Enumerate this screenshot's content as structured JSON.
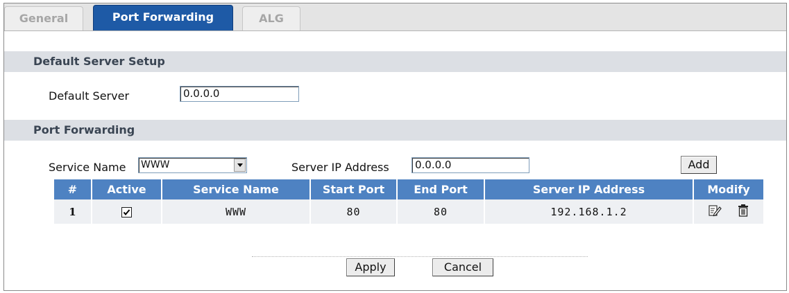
{
  "tabs": [
    {
      "label": "General",
      "active": false
    },
    {
      "label": "Port Forwarding",
      "active": true
    },
    {
      "label": "ALG",
      "active": false
    }
  ],
  "default_server_setup": {
    "title": "Default Server Setup",
    "label": "Default Server",
    "value": "0.0.0.0"
  },
  "port_forwarding": {
    "title": "Port Forwarding",
    "service_name_label": "Service Name",
    "service_name_value": "WWW",
    "server_ip_label": "Server IP Address",
    "server_ip_value": "0.0.0.0",
    "add_label": "Add"
  },
  "table": {
    "headers": [
      "#",
      "Active",
      "Service Name",
      "Start Port",
      "End Port",
      "Server IP Address",
      "Modify"
    ],
    "rows": [
      {
        "index": "1",
        "active": true,
        "service_name": "WWW",
        "start_port": "80",
        "end_port": "80",
        "server_ip": "192.168.1.2"
      }
    ]
  },
  "footer": {
    "apply_label": "Apply",
    "cancel_label": "Cancel"
  },
  "colors": {
    "tab_active": "#1e5aa6",
    "header": "#4e82c2",
    "section_bar": "#dcdfe4",
    "row_bg": "#eef0f3"
  },
  "icons": {
    "edit": "edit-icon",
    "delete": "trash-icon"
  }
}
